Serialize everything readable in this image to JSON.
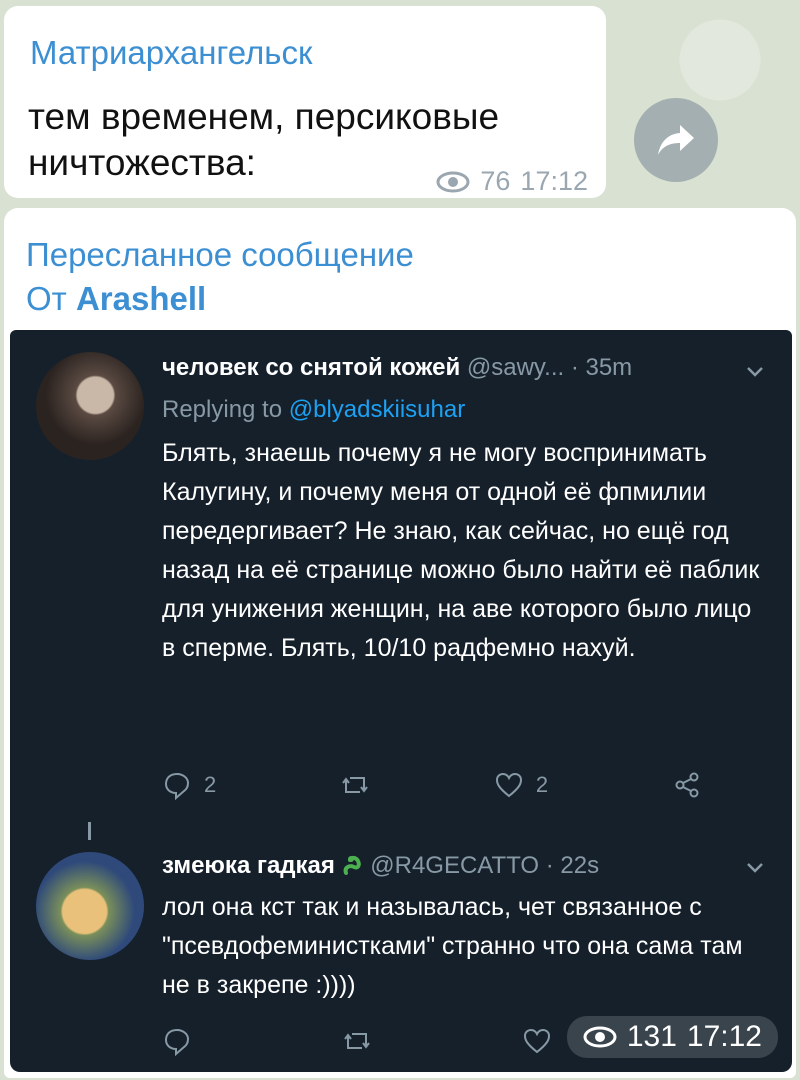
{
  "channel_message": {
    "channel_name": "Матриархангельск",
    "text": "тем временем, персиковые ничтожества:",
    "views": "76",
    "time": "17:12"
  },
  "forwarded_message": {
    "title": "Пересланное сообщение",
    "from_prefix": "От",
    "from_name": "Arashell",
    "views": "131",
    "time": "17:12"
  },
  "tweets": [
    {
      "name": "человек со снятой кожей",
      "handle": "@sawy...",
      "age": "· 35m",
      "replying_prefix": "Replying to",
      "replying_to": "@blyadskiisuhar",
      "text": "Блять, знаешь почему я не могу воспринимать Калугину, и почему меня от одной её фпмилии передергивает? Не знаю, как сейчас, но ещё год назад на её странице можно было найти её паблик для унижения женщин, на аве которого было лицо в сперме. Блять, 10/10 радфемно нахуй.",
      "replies": "2",
      "retweets": "",
      "likes": "2"
    },
    {
      "name": "змеюка гадкая",
      "handle": "@R4GECATTO",
      "age": "· 22s",
      "text": "лол она кст так и называлась, чет связанное с \"псевдофеминистками\" странно что она сама там не в закрепе :))))",
      "replies": "",
      "retweets": "",
      "likes": ""
    }
  ],
  "colors": {
    "accent": "#3c8fd2",
    "tweet_bg": "#15202b",
    "tweet_muted": "#8899a6",
    "tweet_link": "#1da1f2"
  },
  "icons": [
    "eye-icon",
    "share-icon",
    "chevron-down-icon",
    "reply-icon",
    "retweet-icon",
    "like-icon",
    "share-tweet-icon",
    "snake-emoji-icon"
  ]
}
